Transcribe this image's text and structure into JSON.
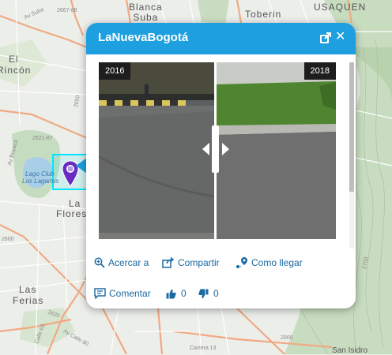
{
  "map": {
    "labels": {
      "blanca_suba": [
        "Blanca",
        "Suba"
      ],
      "toberin": "Toberin",
      "usaquen": "USAQUEN",
      "el_rincon": [
        "El",
        "Rincón"
      ],
      "la_floresta": [
        "La",
        "Flores"
      ],
      "las_ferias": [
        "Las",
        "Ferias"
      ],
      "lake_name": [
        "Lago Club",
        "Los Lagartos"
      ],
      "san_isidro": "San Isidro"
    },
    "street_labels": [
      "Av Suba",
      "2667-88",
      "2621-87",
      "2650",
      "2600",
      "2900",
      "2700",
      "2620",
      "Av Calle 80",
      "Av Boyacá",
      "Calle 63",
      "Carrera 13"
    ],
    "marker_color": "#6a2bc2",
    "highlight_color": "#00e5ff"
  },
  "popup": {
    "title": "LaNuevaBogotá",
    "header_color": "#1d9fe0",
    "icons": {
      "popout": "popout-icon",
      "close": "close-icon"
    },
    "comparison": {
      "left_year": "2016",
      "right_year": "2018",
      "handle": "compare-slider-handle"
    },
    "actions": {
      "zoom_to": "Acercar a",
      "share": "Compartir",
      "directions": "Como llegar",
      "comment": "Comentar",
      "likes": "0",
      "dislikes": "0"
    }
  }
}
